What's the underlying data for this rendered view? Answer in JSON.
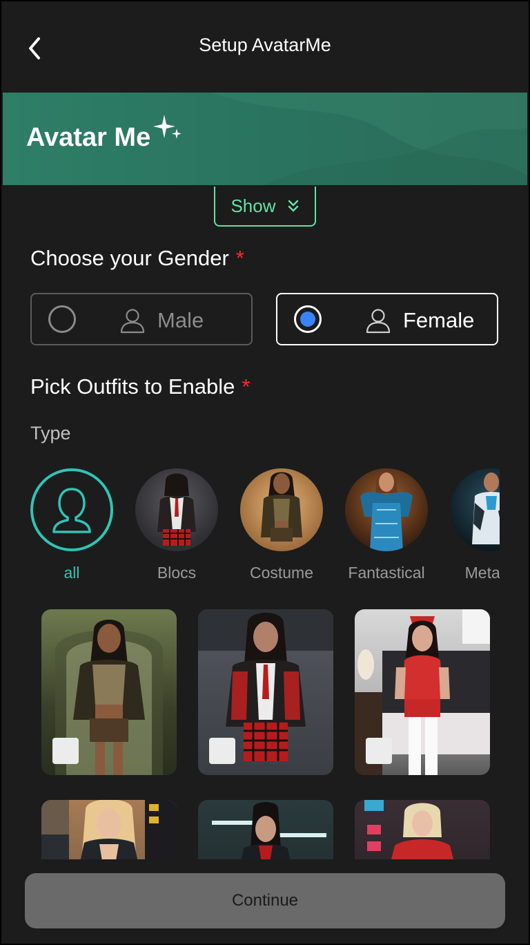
{
  "header": {
    "title": "Setup AvatarMe",
    "back_icon": "chevron-left-icon"
  },
  "banner": {
    "title": "Avatar Me",
    "sparkle_icon": "sparkle-icon",
    "color": "#2a7560"
  },
  "show_toggle": {
    "label": "Show",
    "icon": "double-chevron-down-icon",
    "accent": "#62e2a8"
  },
  "gender": {
    "label": "Choose your Gender",
    "required_mark": "*",
    "options": [
      {
        "label": "Male",
        "selected": false,
        "icon": "user-icon"
      },
      {
        "label": "Female",
        "selected": true,
        "icon": "user-icon"
      }
    ],
    "selected_color": "#3b82f6"
  },
  "outfits": {
    "label": "Pick Outfits to Enable",
    "required_mark": "*",
    "type_label": "Type",
    "types": [
      {
        "label": "all",
        "active": true,
        "icon": "female-user-icon"
      },
      {
        "label": "Blocs",
        "active": false
      },
      {
        "label": "Costume",
        "active": false
      },
      {
        "label": "Fantastical",
        "active": false
      },
      {
        "label": "Metahu",
        "active": false
      }
    ],
    "active_color": "#2ec4b6"
  },
  "continue_label": "Continue",
  "required_color": "#ff2b2b"
}
